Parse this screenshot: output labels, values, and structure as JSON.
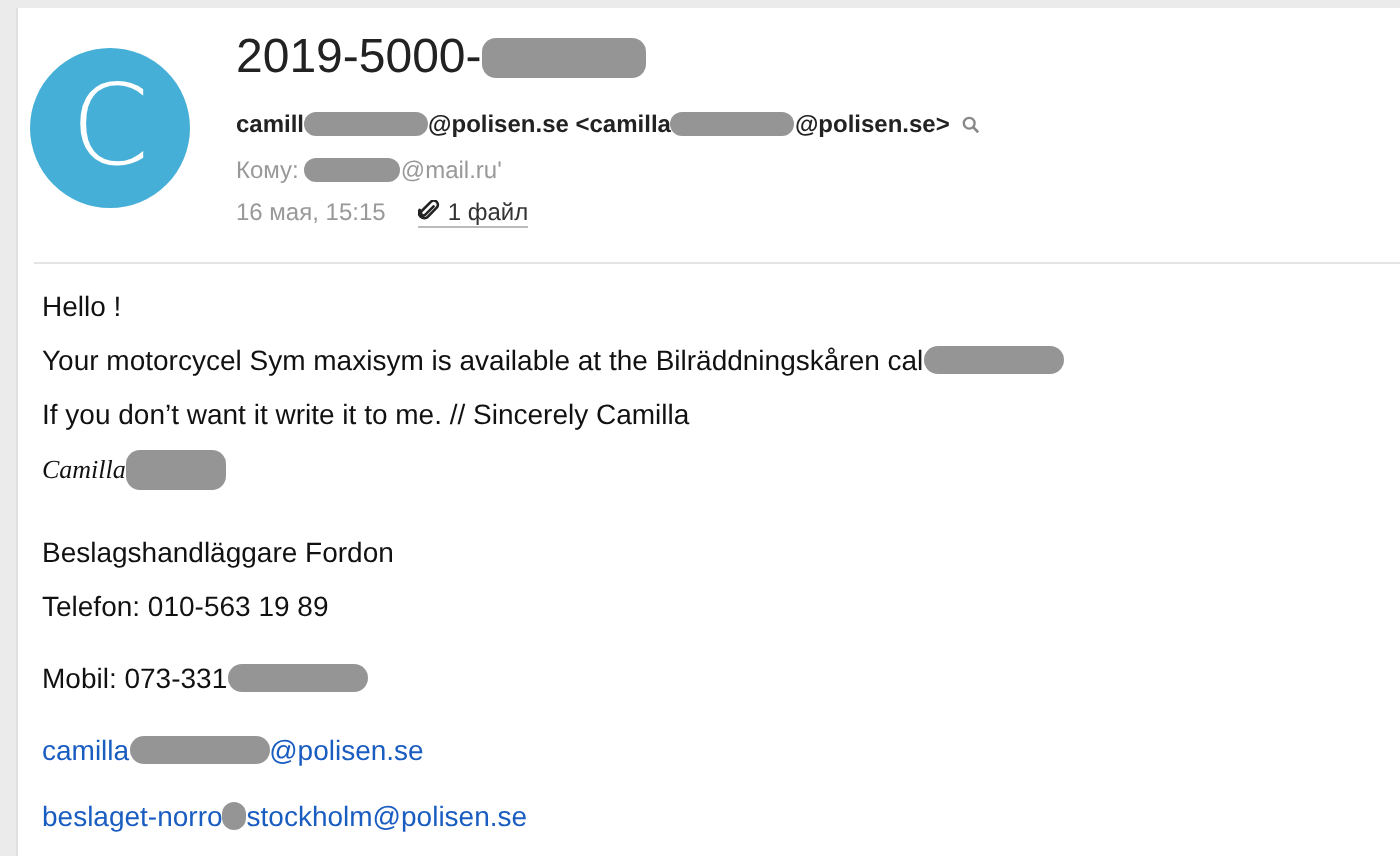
{
  "header": {
    "avatar_letter": "C",
    "subject": [
      {
        "kind": "text",
        "text": "2019-5000-"
      },
      {
        "kind": "redaction"
      }
    ],
    "sender": [
      {
        "kind": "text",
        "text": "camill"
      },
      {
        "kind": "redaction"
      },
      {
        "kind": "text",
        "text": "@polisen.se <camilla"
      },
      {
        "kind": "redaction"
      },
      {
        "kind": "text",
        "text": "@polisen.se>"
      }
    ],
    "recipient_label": "Кому:",
    "recipient": [
      {
        "kind": "redaction"
      },
      {
        "kind": "text",
        "text": "@mail.ru'"
      }
    ],
    "date": "16 мая, 15:15",
    "attachment": "1 файл"
  },
  "body": [
    {
      "kind": "text",
      "segments": [
        {
          "kind": "text",
          "text": "Hello !"
        }
      ]
    },
    {
      "kind": "text",
      "segments": [
        {
          "kind": "text",
          "text": "Your motorcycel Sym maxisym is available at the Bilräddningskåren cal"
        },
        {
          "kind": "redaction"
        }
      ]
    },
    {
      "kind": "text",
      "segments": [
        {
          "kind": "text",
          "text": "If you don’t want it write it to me. // Sincerely Camilla"
        }
      ]
    },
    {
      "kind": "signature",
      "segments": [
        {
          "kind": "text",
          "text": "Camilla"
        },
        {
          "kind": "redaction"
        }
      ]
    },
    {
      "kind": "text",
      "segments": [
        {
          "kind": "text",
          "text": "Beslagshandläggare Fordon"
        }
      ]
    },
    {
      "kind": "text",
      "segments": [
        {
          "kind": "text",
          "text": "Telefon: 010-563 19 89"
        }
      ]
    },
    {
      "kind": "text",
      "segments": [
        {
          "kind": "text",
          "text": "Mobil: 073-331"
        },
        {
          "kind": "redaction"
        }
      ]
    },
    {
      "kind": "link",
      "segments": [
        {
          "kind": "text",
          "text": "camilla"
        },
        {
          "kind": "redaction"
        },
        {
          "kind": "text",
          "text": "@polisen.se"
        }
      ]
    },
    {
      "kind": "link",
      "segments": [
        {
          "kind": "text",
          "text": "beslaget-norro"
        },
        {
          "kind": "smudge"
        },
        {
          "kind": "text",
          "text": "stockholm@polisen.se"
        }
      ]
    }
  ]
}
